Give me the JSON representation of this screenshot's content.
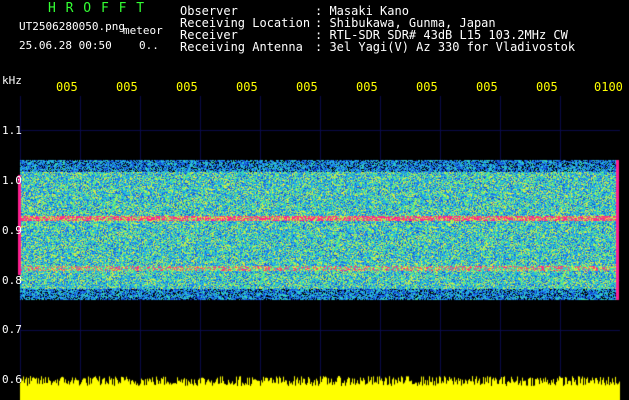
{
  "header": {
    "logo": "H R O F F T",
    "filename": "UT2506280050.png",
    "tag": "meteor",
    "datetime": "25.06.28 00:50",
    "count": "0..",
    "fields": [
      {
        "label": "Observer",
        "value": ": Masaki Kano"
      },
      {
        "label": "Receiving Location",
        "value": ": Shibukawa, Gunma, Japan"
      },
      {
        "label": "Receiver",
        "value": ": RTL-SDR SDR# 43dB L15 103.2MHz CW"
      },
      {
        "label": "Receiving Antenna",
        "value": ": 3el Yagi(V) Az 330 for Vladivostok"
      }
    ]
  },
  "axis": {
    "unit": "kHz",
    "y_ticks": [
      "1.1",
      "1.0",
      "0.9",
      "0.8",
      "0.7",
      "0.6"
    ],
    "x_ticks": [
      "005",
      "005",
      "005",
      "005",
      "005",
      "005",
      "005",
      "005",
      "005",
      "0100"
    ]
  },
  "colors": {
    "logo": "#33ff33",
    "header_text": "#ffffff",
    "time_label": "#ffff00",
    "amplitude": "#ffff00"
  }
}
